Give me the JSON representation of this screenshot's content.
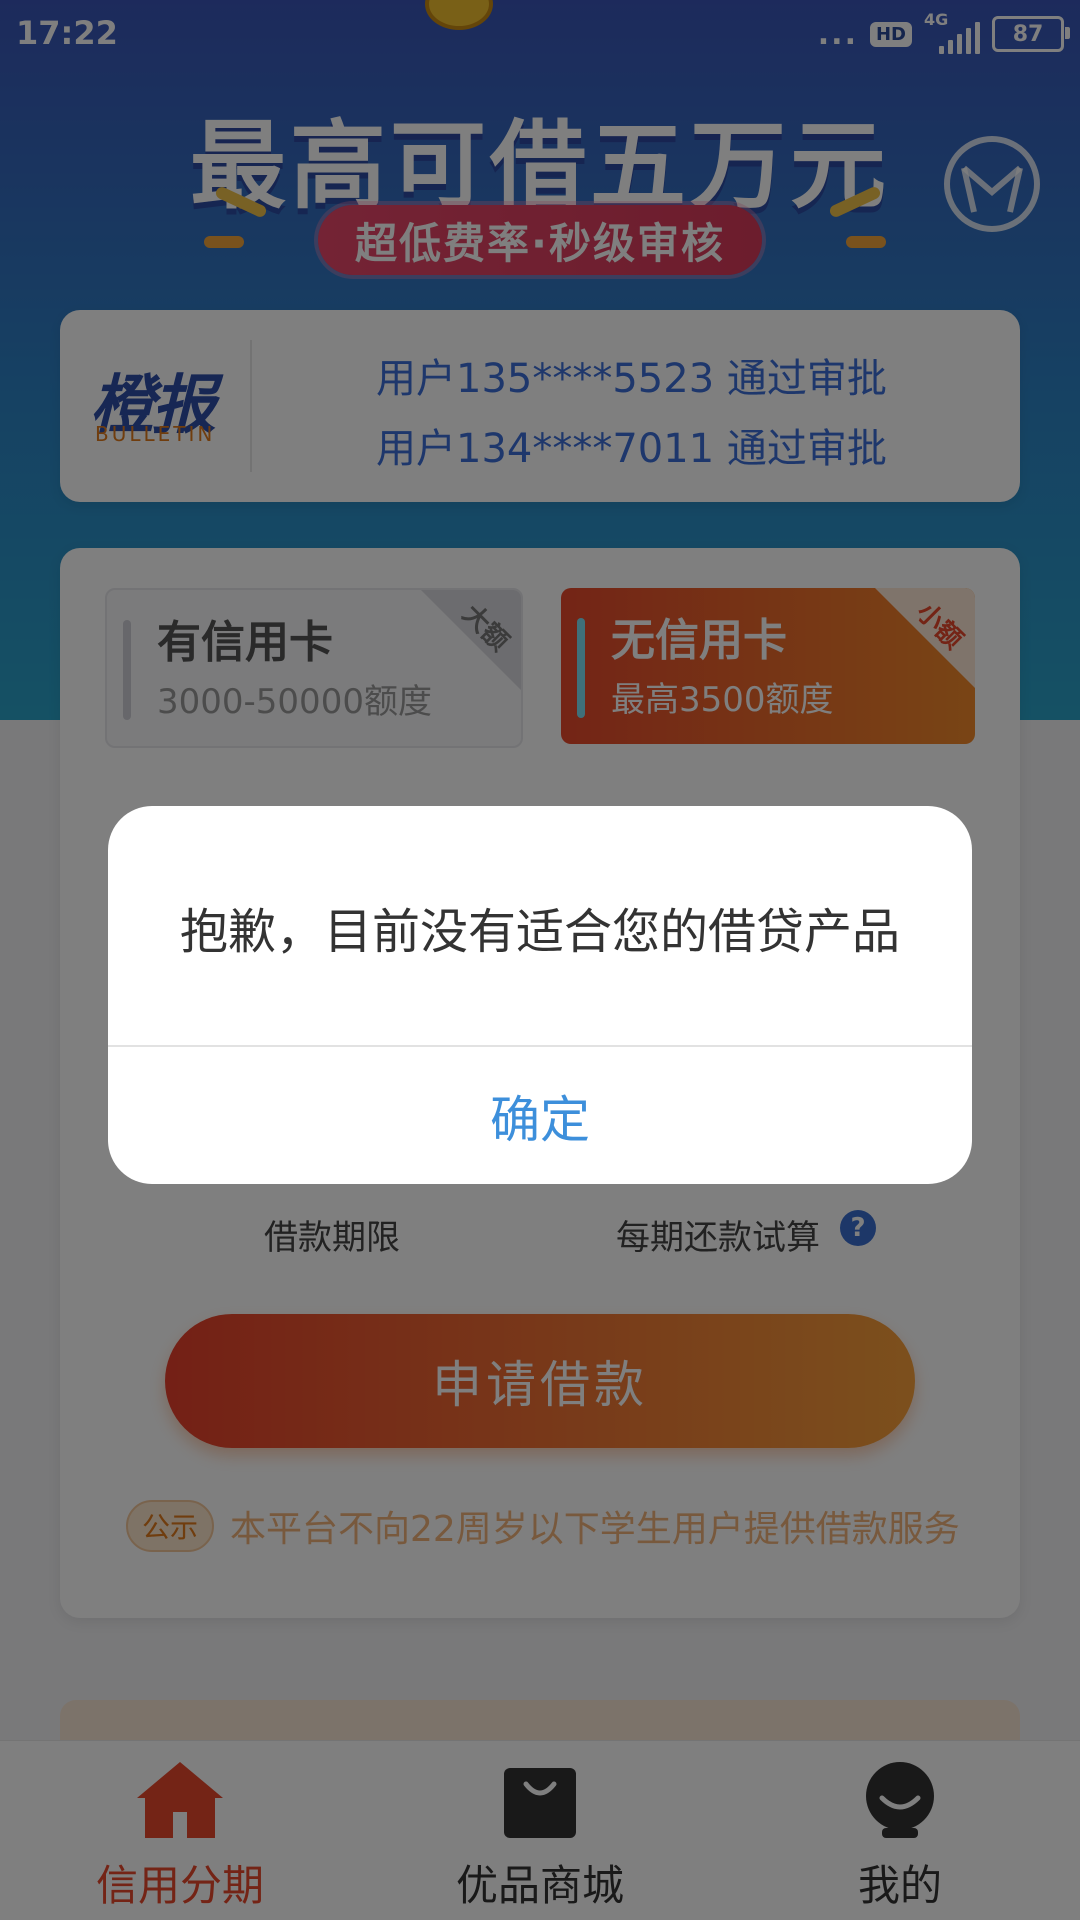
{
  "status_bar": {
    "time": "17:22",
    "dots": "...",
    "hd": "HD",
    "network": "4G",
    "battery": "87"
  },
  "hero": {
    "title": "最高可借五万元",
    "subtitle": "超低费率·秒级审核"
  },
  "bulletin": {
    "logo_cn": "橙报",
    "logo_en": "BULLETIN",
    "lines": [
      "用户135****5523 通过审批",
      "用户134****7011 通过审批"
    ]
  },
  "loan_options": [
    {
      "title": "有信用卡",
      "subtitle": "3000-50000额度",
      "tag": "大额"
    },
    {
      "title": "无信用卡",
      "subtitle": "最高3500额度",
      "tag": "小额"
    }
  ],
  "terms": {
    "period_label": "借款期限",
    "repayment_label": "每期还款试算",
    "help": "?"
  },
  "apply_button": "申请借款",
  "notice": {
    "tag": "公示",
    "text": "本平台不向22周岁以下学生用户提供借款服务"
  },
  "tabs": [
    {
      "label": "信用分期",
      "icon": "home-icon",
      "active": true
    },
    {
      "label": "优品商城",
      "icon": "shopping-bag-icon",
      "active": false
    },
    {
      "label": "我的",
      "icon": "profile-icon",
      "active": false
    }
  ],
  "dialog": {
    "message": "抱歉，目前没有适合您的借贷产品",
    "confirm": "确定"
  },
  "colors": {
    "accent": "#e8492c",
    "dialog_button": "#3d8fdb",
    "hero_blue": "#3a55b8"
  }
}
